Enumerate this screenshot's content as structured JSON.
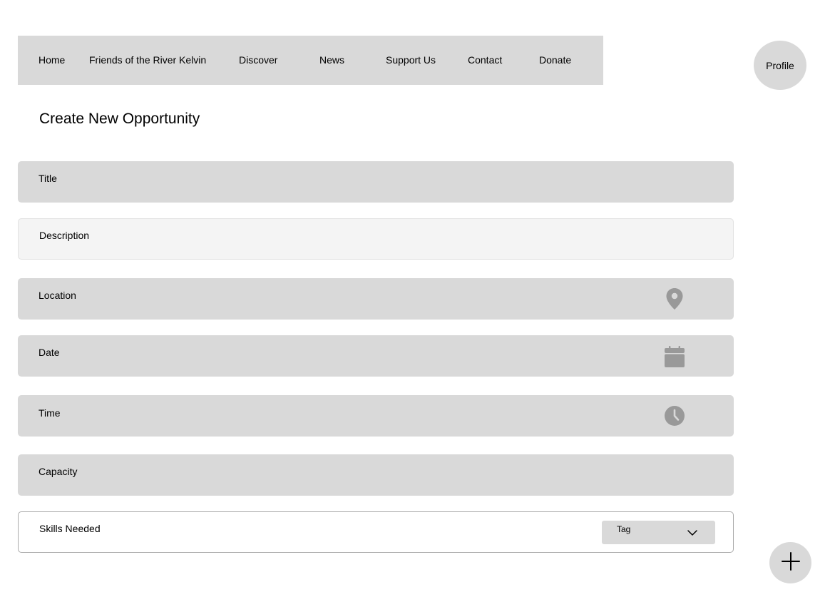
{
  "nav": {
    "items": [
      {
        "label": "Home"
      },
      {
        "label": "Friends of the River Kelvin"
      },
      {
        "label": "Discover"
      },
      {
        "label": "News"
      },
      {
        "label": "Support Us"
      },
      {
        "label": "Contact"
      },
      {
        "label": "Donate"
      }
    ]
  },
  "profile": {
    "label": "Profile"
  },
  "page": {
    "title": "Create New Opportunity"
  },
  "form": {
    "title_label": "Title",
    "description_label": "Description",
    "location_label": "Location",
    "location_icon": "map-pin-icon",
    "date_label": "Date",
    "date_icon": "calendar-icon",
    "time_label": "Time",
    "time_icon": "clock-icon",
    "capacity_label": "Capacity",
    "skills_label": "Skills Needed",
    "skills_select": {
      "selected": "Tag"
    }
  },
  "fab": {
    "icon": "plus-icon"
  },
  "colors": {
    "panel": "#d9d9d9",
    "panel_light": "#f4f4f4",
    "icon": "#999999"
  }
}
